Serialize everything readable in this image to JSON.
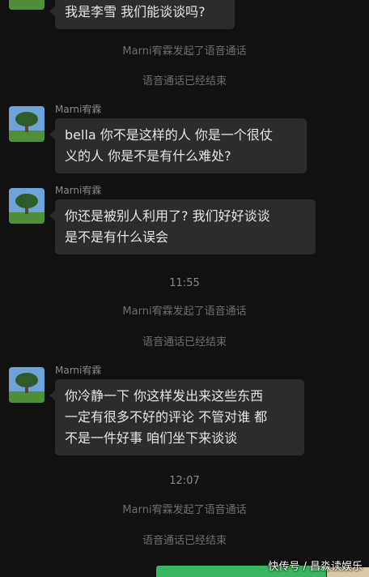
{
  "messages": [
    {
      "sender": "",
      "lines": [
        "我是李雪 我们能谈谈吗?"
      ]
    },
    {
      "sender": "Marni宥霖",
      "lines": [
        "bella 你不是这样的人 你是一个很仗",
        "义的人 你是不是有什么难处?"
      ]
    },
    {
      "sender": "Marni宥霖",
      "lines": [
        "你还是被别人利用了?  我们好好谈谈",
        "是不是有什么误会"
      ]
    },
    {
      "sender": "Marni宥霖",
      "lines": [
        "你冷静一下 你这样发出来这些东西",
        "一定有很多不好的评论 不管对谁 都",
        "不是一件好事 咱们坐下来谈谈"
      ]
    }
  ],
  "system": {
    "call_started": "Marni宥霖发起了语音通话",
    "call_ended": "语音通话已经结束"
  },
  "times": [
    "11:55",
    "12:07"
  ],
  "watermark": "快传号 / 昌淼读娱乐",
  "colors": {
    "background": "#111111",
    "bubble": "#2c2c2c",
    "accent_green": "#3bb55f"
  }
}
